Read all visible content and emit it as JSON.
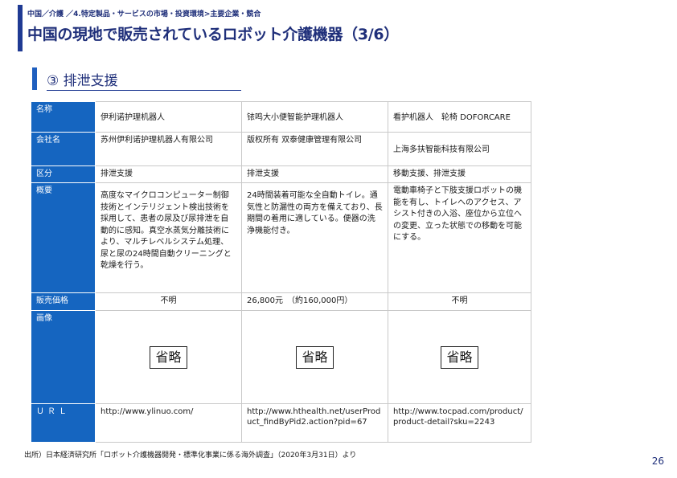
{
  "header": {
    "breadcrumb": "中国／介護 ／4.特定製品・サービスの市場・投資環境>主要企業・競合",
    "title": "中国の現地で販売されているロボット介護機器（3/6）"
  },
  "section": {
    "subtitle": "③ 排泄支援"
  },
  "table": {
    "row_labels": [
      "名称",
      "会社名",
      "区分",
      "概要",
      "販売価格",
      "画像",
      "ＵＲＬ"
    ],
    "products": [
      {
        "name": "伊利诺护理机器人",
        "company": "苏州伊利诺护理机器人有限公司",
        "category": "排泄支援",
        "overview": "高度なマイクロコンピューター制御技術とインテリジェント検出技術を採用して、患者の尿及び尿排泄を自動的に感知。真空水蒸気分離技術により、マルチレベルシステム処理、尿と尿の24時間自動クリーニングと乾燥を行う。",
        "price": "不明",
        "image": "省略",
        "url": "http://www.ylinuo.com/"
      },
      {
        "name": "铱鸣大小便智能护理机器人",
        "company": "版权所有 双泰健康管理有限公司",
        "category": "排泄支援",
        "overview": "24時間装着可能な全自動トイレ。通気性と防漏性の両方を備えており、長期間の着用に適している。便器の洗浄機能付き。",
        "price": "26,800元　（約160,000円）",
        "image": "省略",
        "url": "http://www.hthealth.net/userProduct_findByPid2.action?pid=67"
      },
      {
        "name": "看护机器人　轮椅 DOFORCARE",
        "company": "上海多扶智能科技有限公司",
        "category": "移動支援、排泄支援",
        "overview": "電動車椅子と下肢支援ロボットの機能を有し、トイレへのアクセス、アシスト付きの入浴、座位から立位への変更、立った状態での移動を可能にする。",
        "price": "不明",
        "image": "省略",
        "url": "http://www.tocpad.com/product/product-detail?sku=2243"
      }
    ]
  },
  "footer": {
    "source": "出所）日本経済研究所「ロボット介護機器開発・標準化事業に係る海外調査」（2020年3月31日）より",
    "page_number": "26"
  },
  "colors": {
    "accent": "#1f3a93",
    "header_cell": "#1565c0",
    "title_text": "#1f2f7a"
  }
}
